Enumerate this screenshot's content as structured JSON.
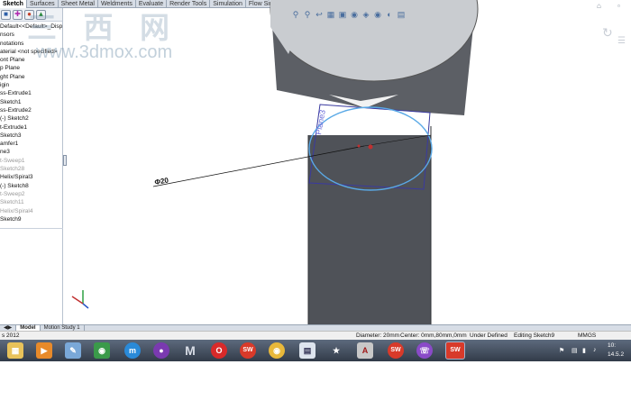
{
  "tabs": [
    "Sketch",
    "Surfaces",
    "Sheet Metal",
    "Weldments",
    "Evaluate",
    "Render Tools",
    "Simulation",
    "Flow Simulation"
  ],
  "active_tab": "Sketch",
  "watermark": {
    "cn": "三 西 网",
    "en": "www.3dmox.com"
  },
  "panel": {
    "toolbar_icons": [
      "part-icon",
      "property-icon",
      "config-icon",
      "display-icon"
    ],
    "tree": [
      {
        "label": "Default<<Default>_Displa",
        "muted": false
      },
      {
        "label": "nsors",
        "muted": false
      },
      {
        "label": "notations",
        "muted": false
      },
      {
        "label": "aterial <not specified>",
        "muted": false
      },
      {
        "label": "ont Plane",
        "muted": false
      },
      {
        "label": "p Plane",
        "muted": false
      },
      {
        "label": "ght Plane",
        "muted": false
      },
      {
        "label": "igin",
        "muted": false
      },
      {
        "label": "ss-Extrude1",
        "muted": false
      },
      {
        "label": "Sketch1",
        "muted": false
      },
      {
        "label": "ss-Extrude2",
        "muted": false
      },
      {
        "label": "(-) Sketch2",
        "muted": false
      },
      {
        "label": "t-Extrude1",
        "muted": false
      },
      {
        "label": "Sketch3",
        "muted": false
      },
      {
        "label": "amfer1",
        "muted": false
      },
      {
        "label": "ne3",
        "muted": false
      },
      {
        "label": "t-Sweep1",
        "muted": true
      },
      {
        "label": "Sketch28",
        "muted": true
      },
      {
        "label": "Helix/Spiral3",
        "muted": false
      },
      {
        "label": "(-) Sketch8",
        "muted": false
      },
      {
        "label": "t-Sweep2",
        "muted": true
      },
      {
        "label": "Sketch11",
        "muted": true
      },
      {
        "label": "Helix/Spiral4",
        "muted": true
      },
      {
        "label": "Sketch9",
        "muted": false
      }
    ]
  },
  "viewport": {
    "dimension_text": "Φ20",
    "plane_label": "Plane3"
  },
  "bottom_tabs": [
    "Model",
    "Motion Study 1"
  ],
  "status": {
    "left": "s 2012",
    "diameter": "Diameter: 20mm",
    "center": "Center: 0mm,80mm,0mm",
    "state": "Under Defined",
    "editing": "Editing Sketch9",
    "units": "MMGS"
  },
  "taskbar": {
    "clock_time": "10:",
    "clock_date": "14.5.2"
  },
  "colors": {
    "model_body": "#4f5258",
    "model_top": "#c9ccd0",
    "sketch_circle": "#5aa9e6",
    "plane": "#3a3aa0",
    "accent": "#d7dde6"
  }
}
